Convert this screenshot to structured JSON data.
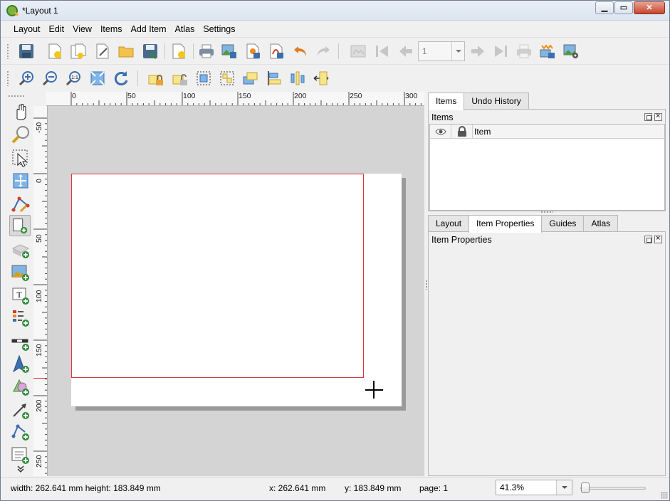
{
  "window": {
    "title": "*Layout 1",
    "controls": {
      "minimize": "▁",
      "maximize": "▭",
      "close": "✕"
    }
  },
  "menu": [
    "Layout",
    "Edit",
    "View",
    "Items",
    "Add Item",
    "Atlas",
    "Settings"
  ],
  "toolbar1": {
    "icons": [
      "save-icon",
      "new-layout-icon",
      "duplicate-layout-icon",
      "layout-manager-icon",
      "open-template-icon",
      "save-template-icon",
      "add-pages-icon",
      "print-icon",
      "export-image-icon",
      "export-svg-icon",
      "export-pdf-icon",
      "undo-icon",
      "redo-icon",
      "atlas-preview-icon",
      "first-feature-icon",
      "previous-feature-icon",
      "next-feature-icon",
      "last-feature-icon",
      "print-atlas-icon",
      "export-atlas-image-icon",
      "atlas-settings-icon"
    ],
    "atlas_page_value": "1"
  },
  "toolbar2": {
    "icons": [
      "zoom-in-icon",
      "zoom-out-icon",
      "zoom-actual-icon",
      "zoom-full-icon",
      "refresh-icon",
      "lock-items-icon",
      "unlock-items-icon",
      "group-items-icon",
      "ungroup-items-icon",
      "raise-items-icon",
      "align-items-icon",
      "distribute-items-icon",
      "resize-items-icon"
    ]
  },
  "tools": [
    "pan-icon",
    "zoom-tool-icon",
    "select-move-icon",
    "move-content-icon",
    "edit-nodes-icon",
    "add-map-icon",
    "add-3d-map-icon",
    "add-picture-icon",
    "add-label-icon",
    "add-legend-icon",
    "add-scalebar-icon",
    "add-north-arrow-icon",
    "add-shape-icon",
    "add-arrow-icon",
    "add-node-item-icon",
    "add-html-icon",
    "more-tools-icon"
  ],
  "ruler": {
    "top_labels": [
      "0",
      "50",
      "100",
      "150",
      "200",
      "250",
      "300"
    ],
    "left_labels": [
      "-50",
      "0",
      "50",
      "100",
      "150",
      "200",
      "250"
    ]
  },
  "dock": {
    "top_tabs": [
      "Items",
      "Undo History"
    ],
    "items_panel": {
      "title": "Items",
      "column_item": "Item"
    },
    "bottom_tabs": [
      "Layout",
      "Item Properties",
      "Guides",
      "Atlas"
    ],
    "item_properties_panel": {
      "title": "Item Properties"
    }
  },
  "status": {
    "size": "width: 262.641 mm height: 183.849 mm",
    "x": "x: 262.641 mm",
    "y": "y: 183.849 mm",
    "page": "page: 1",
    "zoom": "41.3%",
    "zoom_slider_fraction": 0.05
  },
  "colors": {
    "selection": "#d9363e",
    "canvas": "#d4d4d4"
  }
}
